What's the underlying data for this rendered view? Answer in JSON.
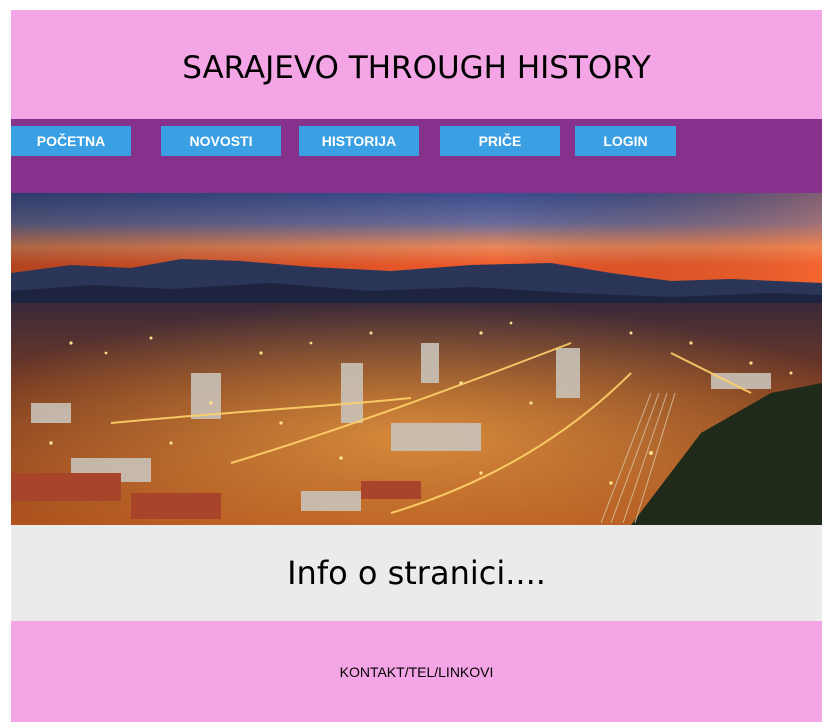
{
  "header": {
    "title": "SARAJEVO THROUGH HISTORY"
  },
  "nav": {
    "items": [
      {
        "label": "POČETNA"
      },
      {
        "label": "NOVOSTI"
      },
      {
        "label": "HISTORIJA"
      },
      {
        "label": "PRIČE"
      },
      {
        "label": "LOGIN"
      }
    ]
  },
  "hero": {
    "image": "sarajevo-night-cityscape"
  },
  "info": {
    "heading": "Info o stranici...."
  },
  "footer": {
    "text": "KONTAKT/TEL/LINKOVI"
  },
  "colors": {
    "header_bg": "#f3a5e5",
    "nav_bg": "#86318c",
    "button_bg": "#3a9fe3",
    "info_bg": "#ebebeb"
  }
}
